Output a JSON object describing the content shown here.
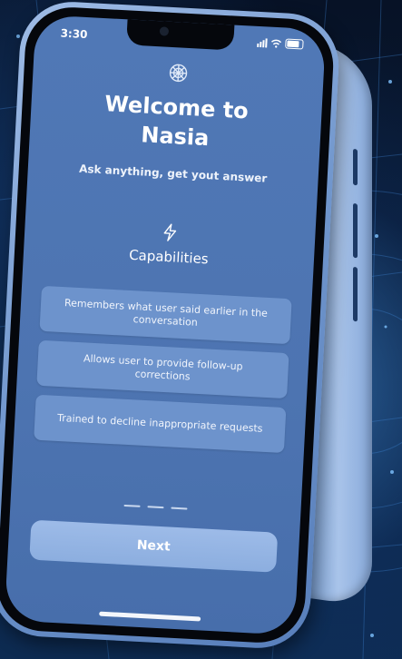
{
  "status_bar": {
    "time": "3:30"
  },
  "welcome": {
    "title_line1": "Welcome to",
    "title_line2": "Nasia",
    "subtitle": "Ask anything, get yout answer"
  },
  "capabilities": {
    "heading": "Capabilities",
    "items": [
      {
        "text": "Remembers what user said earlier in the conversation"
      },
      {
        "text": "Allows user to provide follow-up corrections"
      },
      {
        "text": "Trained to decline inappropriate requests"
      }
    ]
  },
  "pager": {
    "total": 3
  },
  "actions": {
    "next_label": "Next"
  },
  "icons": {
    "logo": "nasia-logo-icon",
    "capabilities": "lightning-bolt-icon"
  },
  "colors": {
    "screen": "#4d74b1",
    "card": "#6d93cc",
    "button": "#9dbbe8"
  }
}
